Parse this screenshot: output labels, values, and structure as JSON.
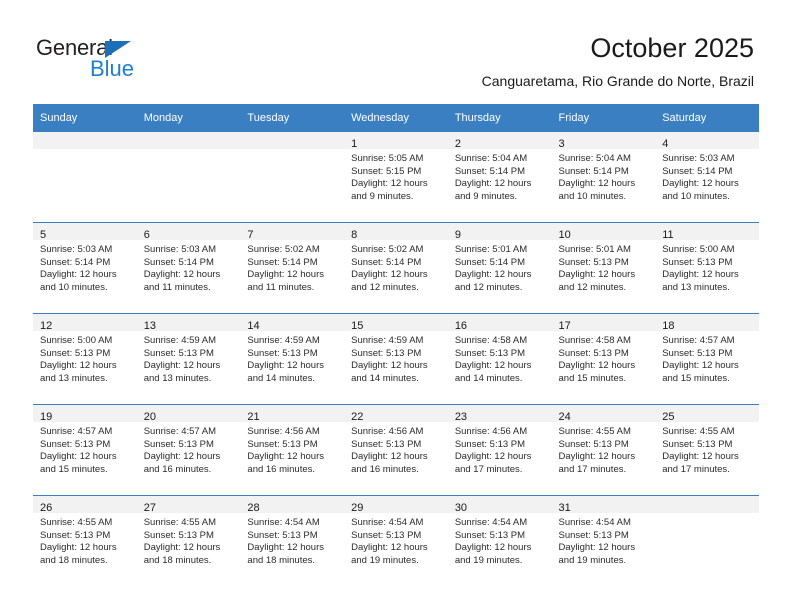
{
  "brand": {
    "name_part1": "General",
    "name_part2": "Blue",
    "accent_color": "#1d7fd0",
    "triangle_color": "#1d6fb8"
  },
  "header": {
    "title": "October 2025",
    "location": "Canguaretama, Rio Grande do Norte, Brazil"
  },
  "theme": {
    "header_band_color": "#3a7fc1",
    "daynum_band_color": "#f2f2f2",
    "text_color": "#1a1a1a"
  },
  "weekdays": [
    "Sunday",
    "Monday",
    "Tuesday",
    "Wednesday",
    "Thursday",
    "Friday",
    "Saturday"
  ],
  "weeks": [
    [
      {
        "day": "",
        "sunrise": "",
        "sunset": "",
        "daylight": "",
        "empty": true
      },
      {
        "day": "",
        "sunrise": "",
        "sunset": "",
        "daylight": "",
        "empty": true
      },
      {
        "day": "",
        "sunrise": "",
        "sunset": "",
        "daylight": "",
        "empty": true
      },
      {
        "day": "1",
        "sunrise": "Sunrise: 5:05 AM",
        "sunset": "Sunset: 5:15 PM",
        "daylight": "Daylight: 12 hours and 9 minutes."
      },
      {
        "day": "2",
        "sunrise": "Sunrise: 5:04 AM",
        "sunset": "Sunset: 5:14 PM",
        "daylight": "Daylight: 12 hours and 9 minutes."
      },
      {
        "day": "3",
        "sunrise": "Sunrise: 5:04 AM",
        "sunset": "Sunset: 5:14 PM",
        "daylight": "Daylight: 12 hours and 10 minutes."
      },
      {
        "day": "4",
        "sunrise": "Sunrise: 5:03 AM",
        "sunset": "Sunset: 5:14 PM",
        "daylight": "Daylight: 12 hours and 10 minutes."
      }
    ],
    [
      {
        "day": "5",
        "sunrise": "Sunrise: 5:03 AM",
        "sunset": "Sunset: 5:14 PM",
        "daylight": "Daylight: 12 hours and 10 minutes."
      },
      {
        "day": "6",
        "sunrise": "Sunrise: 5:03 AM",
        "sunset": "Sunset: 5:14 PM",
        "daylight": "Daylight: 12 hours and 11 minutes."
      },
      {
        "day": "7",
        "sunrise": "Sunrise: 5:02 AM",
        "sunset": "Sunset: 5:14 PM",
        "daylight": "Daylight: 12 hours and 11 minutes."
      },
      {
        "day": "8",
        "sunrise": "Sunrise: 5:02 AM",
        "sunset": "Sunset: 5:14 PM",
        "daylight": "Daylight: 12 hours and 12 minutes."
      },
      {
        "day": "9",
        "sunrise": "Sunrise: 5:01 AM",
        "sunset": "Sunset: 5:14 PM",
        "daylight": "Daylight: 12 hours and 12 minutes."
      },
      {
        "day": "10",
        "sunrise": "Sunrise: 5:01 AM",
        "sunset": "Sunset: 5:13 PM",
        "daylight": "Daylight: 12 hours and 12 minutes."
      },
      {
        "day": "11",
        "sunrise": "Sunrise: 5:00 AM",
        "sunset": "Sunset: 5:13 PM",
        "daylight": "Daylight: 12 hours and 13 minutes."
      }
    ],
    [
      {
        "day": "12",
        "sunrise": "Sunrise: 5:00 AM",
        "sunset": "Sunset: 5:13 PM",
        "daylight": "Daylight: 12 hours and 13 minutes."
      },
      {
        "day": "13",
        "sunrise": "Sunrise: 4:59 AM",
        "sunset": "Sunset: 5:13 PM",
        "daylight": "Daylight: 12 hours and 13 minutes."
      },
      {
        "day": "14",
        "sunrise": "Sunrise: 4:59 AM",
        "sunset": "Sunset: 5:13 PM",
        "daylight": "Daylight: 12 hours and 14 minutes."
      },
      {
        "day": "15",
        "sunrise": "Sunrise: 4:59 AM",
        "sunset": "Sunset: 5:13 PM",
        "daylight": "Daylight: 12 hours and 14 minutes."
      },
      {
        "day": "16",
        "sunrise": "Sunrise: 4:58 AM",
        "sunset": "Sunset: 5:13 PM",
        "daylight": "Daylight: 12 hours and 14 minutes."
      },
      {
        "day": "17",
        "sunrise": "Sunrise: 4:58 AM",
        "sunset": "Sunset: 5:13 PM",
        "daylight": "Daylight: 12 hours and 15 minutes."
      },
      {
        "day": "18",
        "sunrise": "Sunrise: 4:57 AM",
        "sunset": "Sunset: 5:13 PM",
        "daylight": "Daylight: 12 hours and 15 minutes."
      }
    ],
    [
      {
        "day": "19",
        "sunrise": "Sunrise: 4:57 AM",
        "sunset": "Sunset: 5:13 PM",
        "daylight": "Daylight: 12 hours and 15 minutes."
      },
      {
        "day": "20",
        "sunrise": "Sunrise: 4:57 AM",
        "sunset": "Sunset: 5:13 PM",
        "daylight": "Daylight: 12 hours and 16 minutes."
      },
      {
        "day": "21",
        "sunrise": "Sunrise: 4:56 AM",
        "sunset": "Sunset: 5:13 PM",
        "daylight": "Daylight: 12 hours and 16 minutes."
      },
      {
        "day": "22",
        "sunrise": "Sunrise: 4:56 AM",
        "sunset": "Sunset: 5:13 PM",
        "daylight": "Daylight: 12 hours and 16 minutes."
      },
      {
        "day": "23",
        "sunrise": "Sunrise: 4:56 AM",
        "sunset": "Sunset: 5:13 PM",
        "daylight": "Daylight: 12 hours and 17 minutes."
      },
      {
        "day": "24",
        "sunrise": "Sunrise: 4:55 AM",
        "sunset": "Sunset: 5:13 PM",
        "daylight": "Daylight: 12 hours and 17 minutes."
      },
      {
        "day": "25",
        "sunrise": "Sunrise: 4:55 AM",
        "sunset": "Sunset: 5:13 PM",
        "daylight": "Daylight: 12 hours and 17 minutes."
      }
    ],
    [
      {
        "day": "26",
        "sunrise": "Sunrise: 4:55 AM",
        "sunset": "Sunset: 5:13 PM",
        "daylight": "Daylight: 12 hours and 18 minutes."
      },
      {
        "day": "27",
        "sunrise": "Sunrise: 4:55 AM",
        "sunset": "Sunset: 5:13 PM",
        "daylight": "Daylight: 12 hours and 18 minutes."
      },
      {
        "day": "28",
        "sunrise": "Sunrise: 4:54 AM",
        "sunset": "Sunset: 5:13 PM",
        "daylight": "Daylight: 12 hours and 18 minutes."
      },
      {
        "day": "29",
        "sunrise": "Sunrise: 4:54 AM",
        "sunset": "Sunset: 5:13 PM",
        "daylight": "Daylight: 12 hours and 19 minutes."
      },
      {
        "day": "30",
        "sunrise": "Sunrise: 4:54 AM",
        "sunset": "Sunset: 5:13 PM",
        "daylight": "Daylight: 12 hours and 19 minutes."
      },
      {
        "day": "31",
        "sunrise": "Sunrise: 4:54 AM",
        "sunset": "Sunset: 5:13 PM",
        "daylight": "Daylight: 12 hours and 19 minutes."
      },
      {
        "day": "",
        "sunrise": "",
        "sunset": "",
        "daylight": "",
        "empty": true
      }
    ]
  ]
}
